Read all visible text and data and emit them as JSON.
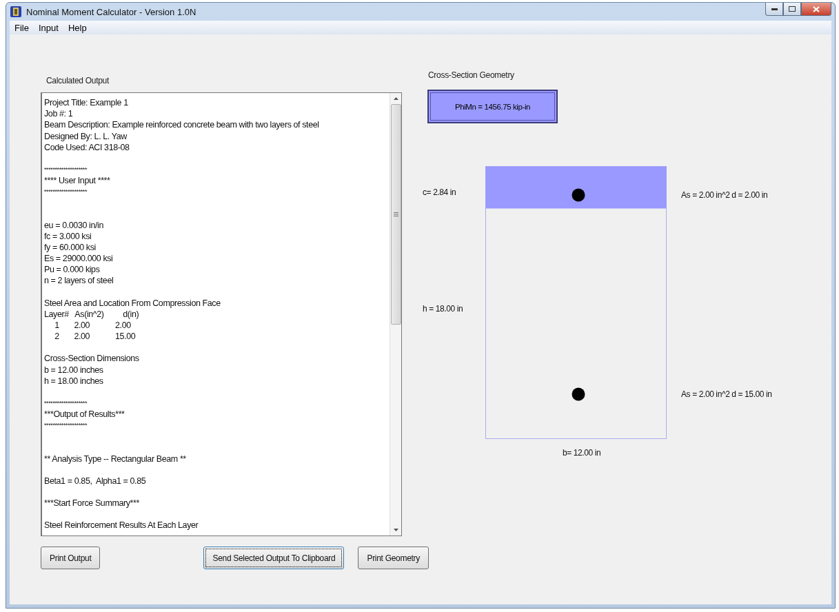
{
  "window": {
    "title": "Nominal Moment Calculator - Version 1.0N"
  },
  "menu": [
    "File",
    "Input",
    "Help"
  ],
  "output_panel": {
    "label": "Calculated Output",
    "blocks": [
      {
        "kind": "text",
        "lines": [
          "Project Title: Example 1",
          "Job #: 1",
          "Beam Description: Example reinforced concrete beam with two layers of steel",
          "Designed By: L. L. Yaw",
          "Code Used: ACI 318-08"
        ]
      },
      {
        "kind": "banner",
        "lines": [
          "********************",
          "**** User Input ****",
          "********************"
        ]
      },
      {
        "kind": "text",
        "lines": [
          "eu = 0.0030 in/in",
          "fc = 3.000 ksi",
          "fy = 60.000 ksi",
          "Es = 29000.000 ksi",
          "Pu = 0.000 kips",
          "n = 2 layers of steel"
        ]
      },
      {
        "kind": "text",
        "lines": [
          "Steel Area and Location From Compression Face",
          "Layer#   As(in^2)         d(in)",
          "     1       2.00            2.00",
          "     2       2.00            15.00"
        ]
      },
      {
        "kind": "text",
        "lines": [
          "Cross-Section Dimensions",
          "b = 12.00 inches",
          "h = 18.00 inches"
        ]
      },
      {
        "kind": "banner",
        "lines": [
          "********************",
          "***Output of Results***",
          "********************"
        ]
      },
      {
        "kind": "text",
        "lines": [
          "** Analysis Type -- Rectangular Beam **"
        ]
      },
      {
        "kind": "text",
        "lines": [
          "Beta1 = 0.85,  Alpha1 = 0.85"
        ]
      },
      {
        "kind": "text",
        "lines": [
          "***Start Force Summary***"
        ]
      },
      {
        "kind": "text",
        "lines": [
          "Steel Reinforcement Results At Each Layer"
        ]
      }
    ]
  },
  "geometry_panel": {
    "label": "Cross-Section Geometry",
    "result": "PhiMn = 1456.75 kip-in",
    "c_label": "c= 2.84 in",
    "h_label": "h = 18.00 in",
    "b_label": "b= 12.00 in",
    "bars": [
      "As = 2.00 in^2  d = 2.00 in",
      "As = 2.00 in^2  d = 15.00 in"
    ]
  },
  "buttons": [
    {
      "label": "Print Output",
      "focused": false
    },
    {
      "label": "Send Selected Output To Clipboard",
      "focused": true
    },
    {
      "label": "Print Geometry",
      "focused": false
    }
  ]
}
